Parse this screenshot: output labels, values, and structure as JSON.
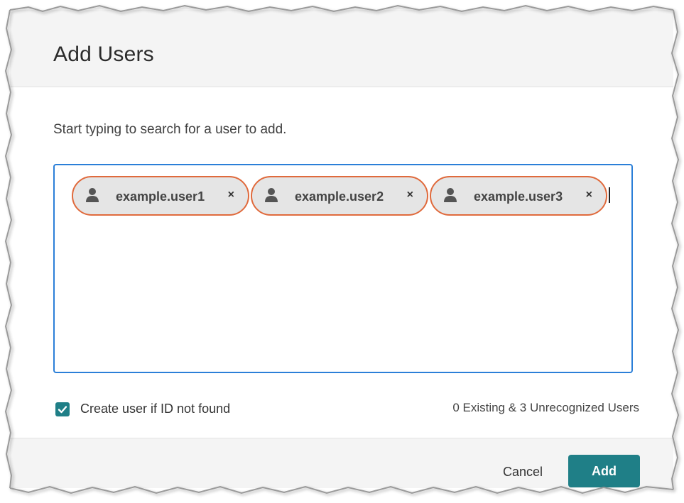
{
  "dialog": {
    "title": "Add Users",
    "instruction": "Start typing to search for a user to add."
  },
  "user_box": {
    "chips": [
      {
        "label": "example.user1",
        "icon": "user-icon",
        "remove": "×"
      },
      {
        "label": "example.user2",
        "icon": "user-icon",
        "remove": "×"
      },
      {
        "label": "example.user3",
        "icon": "user-icon",
        "remove": "×"
      }
    ]
  },
  "options": {
    "create_user_label": "Create user if ID not found",
    "create_user_checked": true,
    "count_text": "0 Existing & 3 Unrecognized Users"
  },
  "footer": {
    "cancel_label": "Cancel",
    "add_label": "Add"
  },
  "colors": {
    "accent": "#1f7f87",
    "focus_border": "#2b7fd8",
    "chip_border": "#e06a3c",
    "chip_bg": "#e5e5e5"
  }
}
